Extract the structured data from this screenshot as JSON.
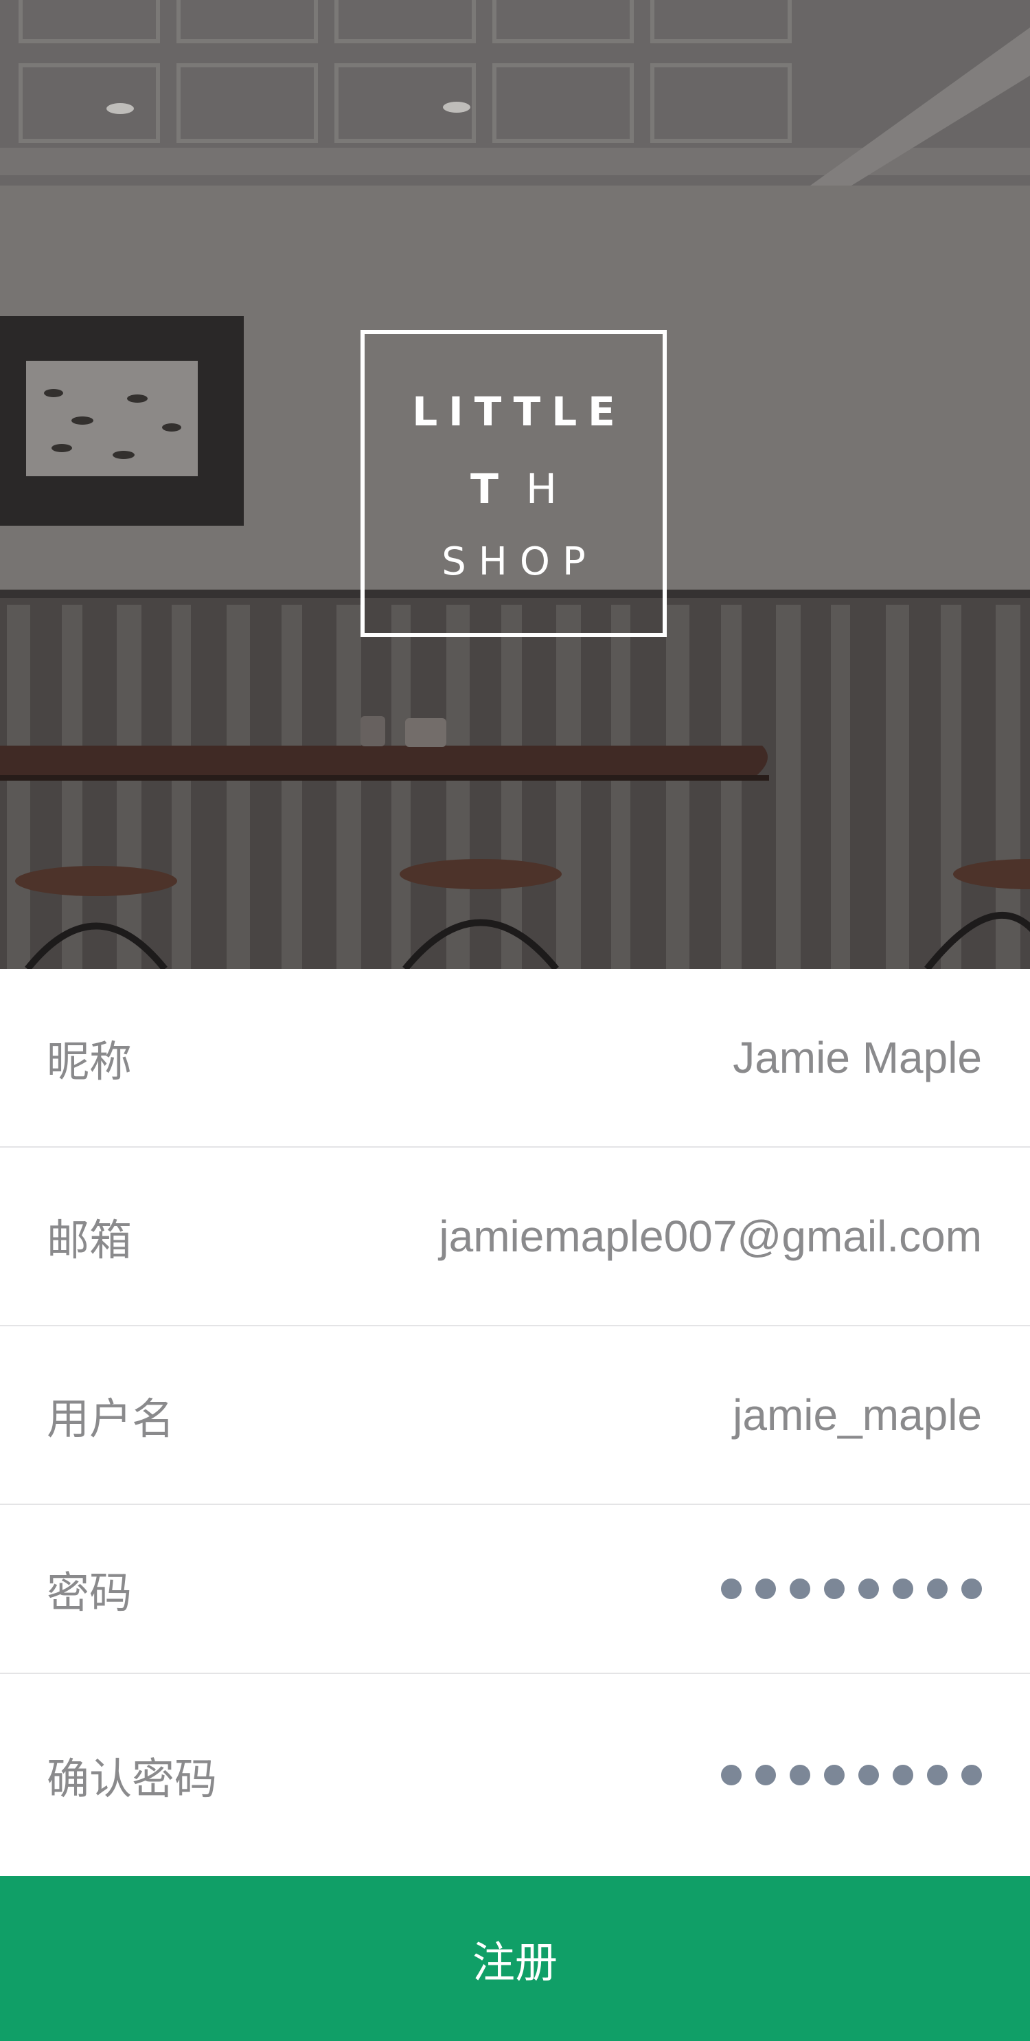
{
  "logo": {
    "line1": "LITTLE",
    "line2_bold": "T",
    "line2_light": "H",
    "line3": "SHOP"
  },
  "form": {
    "fields": [
      {
        "label": "昵称",
        "value": "Jamie Maple"
      },
      {
        "label": "邮箱",
        "value": "jamiemaple007@gmail.com"
      },
      {
        "label": "用户名",
        "value": "jamie_maple"
      },
      {
        "label": "密码",
        "masked_length": 8
      },
      {
        "label": "确认密码",
        "masked_length": 8
      }
    ]
  },
  "submit": {
    "label": "注册"
  },
  "colors": {
    "accent": "#109f67",
    "label": "#8a8a8c",
    "dot": "#7c8797",
    "divider": "#e4e4e6"
  }
}
